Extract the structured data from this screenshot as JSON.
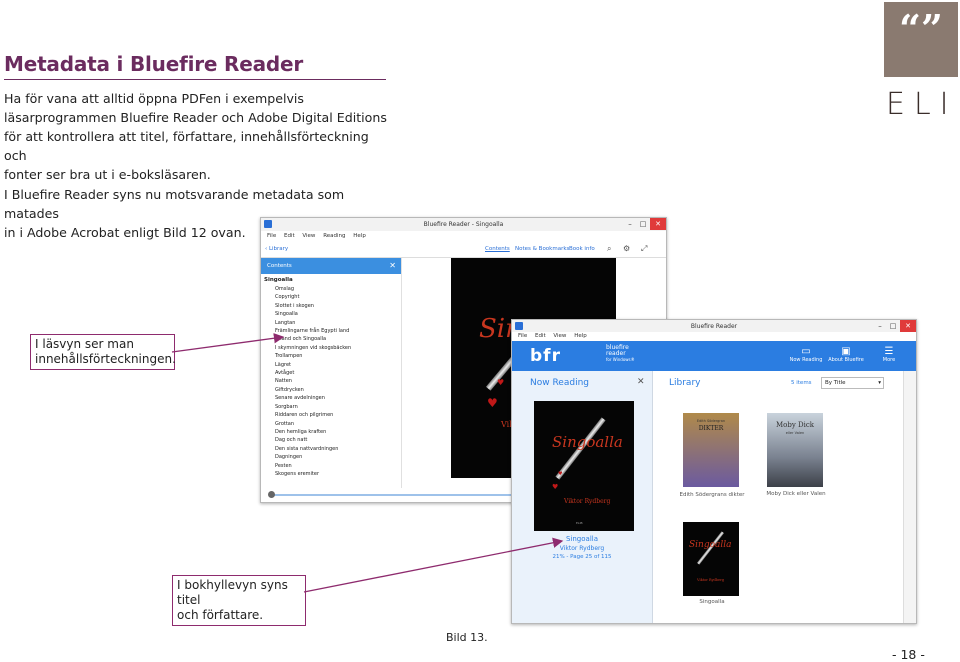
{
  "page": {
    "title": "Metadata i Bluefire Reader",
    "intro_lines": [
      "Ha för vana att alltid öppna PDFen i exempelvis",
      "läsarprogrammen Bluefire Reader och Adobe Digital Editions",
      "för att kontrollera att titel, författare, innehållsförteckning och",
      "fonter ser bra ut i e-boksläsaren."
    ],
    "second_lines": [
      "I Bluefire Reader syns nu motsvarande metadata som matades",
      "in i Adobe Acrobat enligt Bild 12 ovan."
    ],
    "caption": "Bild 13.",
    "page_number": "- 18 -"
  },
  "logo": {
    "quote_mark": "“”",
    "text": "ELIB",
    "box_color": "#8a7a70"
  },
  "callouts": {
    "toc": [
      "I läsvyn ser man",
      "innehållsförteckningen."
    ],
    "shelf": [
      "I bokhyllevyn syns titel",
      "och författare."
    ],
    "border_color": "#8e2b6e"
  },
  "reader_window": {
    "title": "Bluefire Reader - Singoalla",
    "menu": [
      "File",
      "Edit",
      "View",
      "Reading",
      "Help"
    ],
    "back_label": "‹ Library",
    "tabs": [
      "Contents",
      "Notes & Bookmarks",
      "Book info"
    ],
    "toc_header": "Contents",
    "toc_book": "Singoalla",
    "toc_items": [
      "Omslag",
      "Copyright",
      "Slottet i skogen",
      "Singoalla",
      "Langtan",
      "Främlingarne från Egypti land",
      "Erland och Singoalla",
      "I skymningen vid skogsbäcken",
      "Trollampen",
      "Lägret",
      "Avtåget",
      "Natten",
      "Giftdrycken",
      "Senare avdelningen",
      "Sorgbarn",
      "Riddaren och pilgrimen",
      "Grottan",
      "Den hemliga kraften",
      "Dag och natt",
      "Den sista nattvardningen",
      "Dagningen",
      "Pesten",
      "Skogens eremiter"
    ],
    "cover_title": "Sin",
    "cover_author": "Vik"
  },
  "library_window": {
    "title": "Bluefire Reader",
    "menu": [
      "File",
      "Edit",
      "View",
      "Help"
    ],
    "logo": "bfr",
    "logo_sub": [
      "bluefire",
      "reader",
      "for Windows®"
    ],
    "header_buttons": [
      "Now Reading",
      "About Bluefire",
      "More"
    ],
    "now_reading_label": "Now Reading",
    "library_label": "Library",
    "items_count": "5 items",
    "sort_label": "By Title",
    "current_book": {
      "cover_title": "Singoalla",
      "cover_author": "Viktor Rydberg",
      "cover_publisher": "ELIB",
      "title": "Singoalla",
      "author": "Viktor Rydberg",
      "progress": "21% - Page 25 of 115"
    },
    "books": [
      {
        "title": "Edith Södergrans dikter",
        "cover_text": "DIKTER",
        "cover_small": "Edith Södergran"
      },
      {
        "title": "Moby Dick eller Valen",
        "cover_text": "Moby Dick",
        "cover_small": "eller Valen"
      },
      {
        "title": "Singoalla",
        "cover_text": "Singoalla",
        "cover_small": "Viktor Rydberg"
      }
    ]
  }
}
